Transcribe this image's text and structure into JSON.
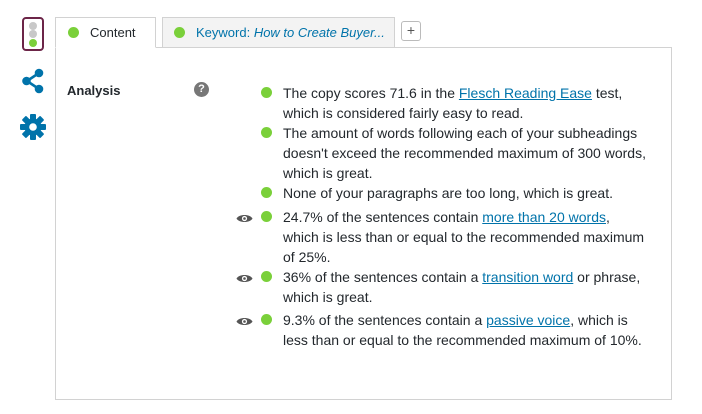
{
  "tabs": [
    {
      "label": "Content"
    },
    {
      "prefix": "Keyword: ",
      "title": "How to Create Buyer..."
    }
  ],
  "add_tab_label": "+",
  "analysis": {
    "label": "Analysis",
    "help_glyph": "?",
    "results": [
      {
        "status": "good",
        "eye": false,
        "before": "The copy scores 71.6 in the ",
        "link": "Flesch Reading Ease",
        "after": " test, which is considered fairly easy to read."
      },
      {
        "status": "good",
        "eye": false,
        "before": "The amount of words following each of your subheadings doesn't exceed the recommended maximum of 300 words, which is great.",
        "link": "",
        "after": ""
      },
      {
        "status": "good",
        "eye": false,
        "before": "None of your paragraphs are too long, which is great.",
        "link": "",
        "after": ""
      },
      {
        "status": "good",
        "eye": true,
        "before": "24.7% of the sentences contain ",
        "link": "more than 20 words",
        "after": ", which is less than or equal to the recommended maximum of 25%."
      },
      {
        "status": "good",
        "eye": true,
        "before": "36% of the sentences contain a ",
        "link": "transition word",
        "after": " or phrase, which is great."
      },
      {
        "status": "good",
        "eye": true,
        "before": "9.3% of the sentences contain a ",
        "link": "passive voice",
        "after": ", which is less than or equal to the recommended maximum of 10%."
      }
    ]
  },
  "colors": {
    "good": "#7ad03a",
    "link": "#0073aa",
    "brand": "#6c2548",
    "icon_blue": "#0073aa"
  },
  "icons": [
    "traffic-light-icon",
    "share-icon",
    "gear-icon",
    "help-icon",
    "eye-icon"
  ]
}
